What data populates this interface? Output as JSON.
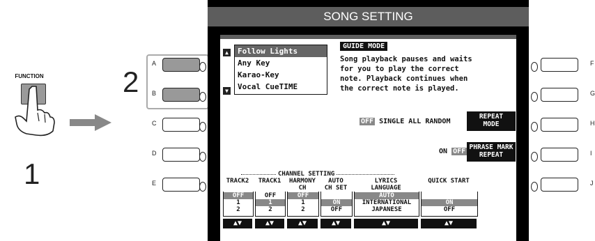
{
  "instruction": {
    "function_label": "FUNCTION",
    "step1": "1",
    "step2": "2"
  },
  "left_buttons": [
    "A",
    "B",
    "C",
    "D",
    "E"
  ],
  "right_buttons": [
    "F",
    "G",
    "H",
    "I",
    "J"
  ],
  "screen": {
    "title": "SONG SETTING",
    "guide_list": [
      "Follow Lights",
      "Any Key",
      "Karao-Key",
      "Vocal CueTIME"
    ],
    "guide_selected": 0,
    "guide_mode_label": "GUIDE MODE",
    "guide_description": [
      "Song playback pauses and waits",
      "for you to play the correct",
      "note. Playback continues when",
      "the correct note is played."
    ],
    "repeat_options": {
      "off": "OFF",
      "single": "SINGLE",
      "all": "ALL",
      "random": "RANDOM"
    },
    "repeat_mode_label": [
      "REPEAT",
      "MODE"
    ],
    "phrase_options": {
      "on": "ON",
      "off": "OFF"
    },
    "phrase_mark_label": [
      "PHRASE MARK",
      "REPEAT"
    ],
    "channel_setting_title": "CHANNEL SETTING",
    "columns": [
      {
        "head": [
          "",
          "TRACK2"
        ],
        "values": [
          "OFF",
          "1",
          "2"
        ],
        "selected": 0,
        "arrow": "▲▼"
      },
      {
        "head": [
          "",
          "TRACK1"
        ],
        "values": [
          "OFF",
          "1",
          "2"
        ],
        "selected": 1,
        "arrow": "▲▼"
      },
      {
        "head": [
          "HARMONY",
          "CH"
        ],
        "values": [
          "OFF",
          "1",
          "2"
        ],
        "selected": 0,
        "arrow": "▲▼"
      },
      {
        "head": [
          "AUTO",
          "CH SET"
        ],
        "values": [
          "",
          "ON",
          "OFF"
        ],
        "selected": 1,
        "arrow": "▲▼"
      },
      {
        "head": [
          "LYRICS",
          "LANGUAGE"
        ],
        "values": [
          "AUTO",
          "INTERNATIONAL",
          "JAPANESE"
        ],
        "selected": 0,
        "arrow": "▲▼"
      },
      {
        "head": [
          "",
          "QUICK START"
        ],
        "values": [
          "",
          "ON",
          "OFF"
        ],
        "selected": 1,
        "arrow": "▲▼"
      }
    ]
  }
}
